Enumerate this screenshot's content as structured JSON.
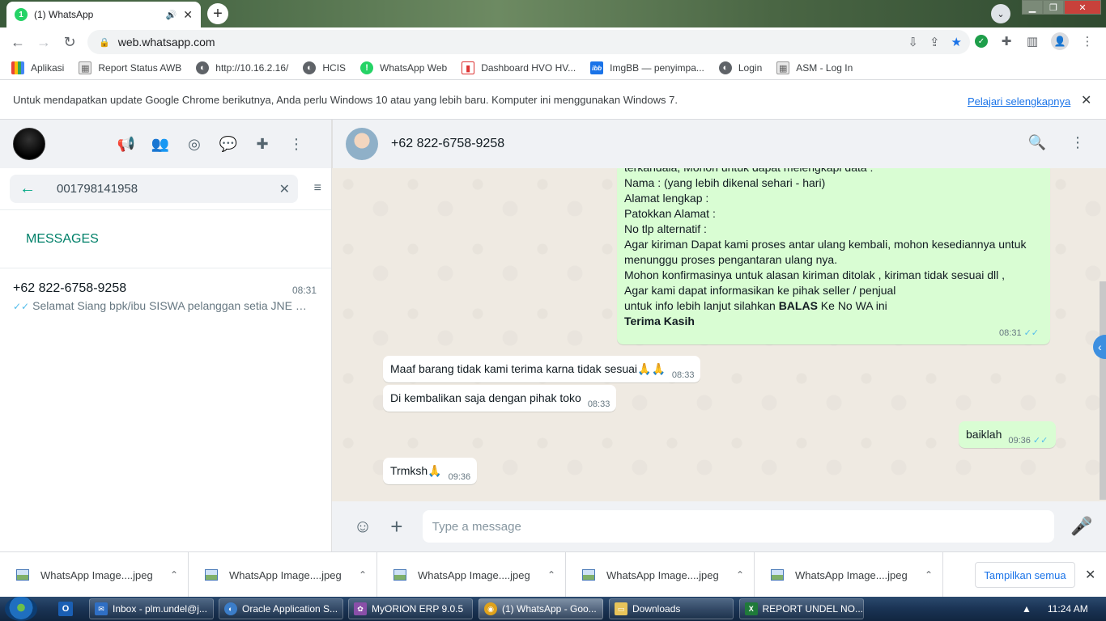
{
  "browser": {
    "tab_title": "(1) WhatsApp",
    "tab_badge": "1",
    "url": "web.whatsapp.com",
    "bookmarks": [
      {
        "label": "Aplikasi",
        "icon": "apps-grid-icon"
      },
      {
        "label": "Report Status AWB",
        "icon": "page-icon"
      },
      {
        "label": "http://10.16.2.16/",
        "icon": "globe-icon"
      },
      {
        "label": "HCIS",
        "icon": "globe-icon"
      },
      {
        "label": "WhatsApp Web",
        "icon": "whatsapp-icon"
      },
      {
        "label": "Dashboard HVO HV...",
        "icon": "hvo-icon"
      },
      {
        "label": "ImgBB — penyimpa...",
        "icon": "ibb-icon"
      },
      {
        "label": "Login",
        "icon": "globe-icon"
      },
      {
        "label": "ASM - Log In",
        "icon": "page-icon"
      }
    ],
    "infobar": {
      "message": "Untuk mendapatkan update Google Chrome berikutnya, Anda perlu Windows 10 atau yang lebih baru. Komputer ini menggunakan Windows 7.",
      "link": "Pelajari selengkapnya"
    }
  },
  "whatsapp": {
    "search_query": "001798141958",
    "section_title": "MESSAGES",
    "result": {
      "name": "+62 822-6758-9258",
      "time": "08:31",
      "preview": "Selamat Siang   bpk/ibu SISWA pelanggan setia JNE EXPRESS"
    },
    "chat": {
      "contact": "+62 822-6758-9258",
      "big_message_lines": [
        "terkandala, Mohon untuk dapat melengkapi data :",
        "Nama : (yang lebih dikenal sehari - hari)",
        "Alamat  lengkap :",
        "Patokkan Alamat :",
        "No tlp alternatif :",
        "Agar kiriman Dapat kami proses antar ulang kembali, mohon kesediannya untuk",
        "menunggu proses pengantaran ulang nya.",
        "Mohon konfirmasinya untuk alasan kiriman ditolak , kiriman tidak sesuai dll ,",
        "Agar kami dapat informasikan ke pihak seller / penjual"
      ],
      "big_message_reply_prefix": "untuk info lebih lanjut silahkan ",
      "big_message_reply_bold": "BALAS",
      "big_message_reply_suffix": " Ke No WA ini",
      "big_message_closing": "Terima Kasih",
      "big_message_time": "08:31",
      "messages": [
        {
          "text": "Maaf barang tidak kami terima karna tidak sesuai🙏🙏",
          "time": "08:33",
          "dir": "in"
        },
        {
          "text": "Di kembalikan saja dengan pihak toko",
          "time": "08:33",
          "dir": "in"
        },
        {
          "text": "baiklah",
          "time": "09:36",
          "dir": "out"
        },
        {
          "text": "Trmksh🙏",
          "time": "09:36",
          "dir": "in"
        }
      ],
      "composer_placeholder": "Type a message"
    }
  },
  "downloads": {
    "items": [
      "WhatsApp Image....jpeg",
      "WhatsApp Image....jpeg",
      "WhatsApp Image....jpeg",
      "WhatsApp Image....jpeg",
      "WhatsApp Image....jpeg"
    ],
    "show_all": "Tampilkan semua"
  },
  "taskbar": {
    "items": [
      {
        "label": "Inbox - plm.undel@j...",
        "color": "#2f6fc4"
      },
      {
        "label": "Oracle Application S...",
        "color": "#3b7dc9"
      },
      {
        "label": "MyORION ERP 9.0.5",
        "color": "#8a4fa8"
      },
      {
        "label": "(1) WhatsApp - Goo...",
        "color": "#e0a21b"
      },
      {
        "label": "Downloads",
        "color": "#e8c45a"
      },
      {
        "label": "REPORT UNDEL NO...",
        "color": "#1f7a3a"
      }
    ],
    "time": "11:24 AM"
  }
}
